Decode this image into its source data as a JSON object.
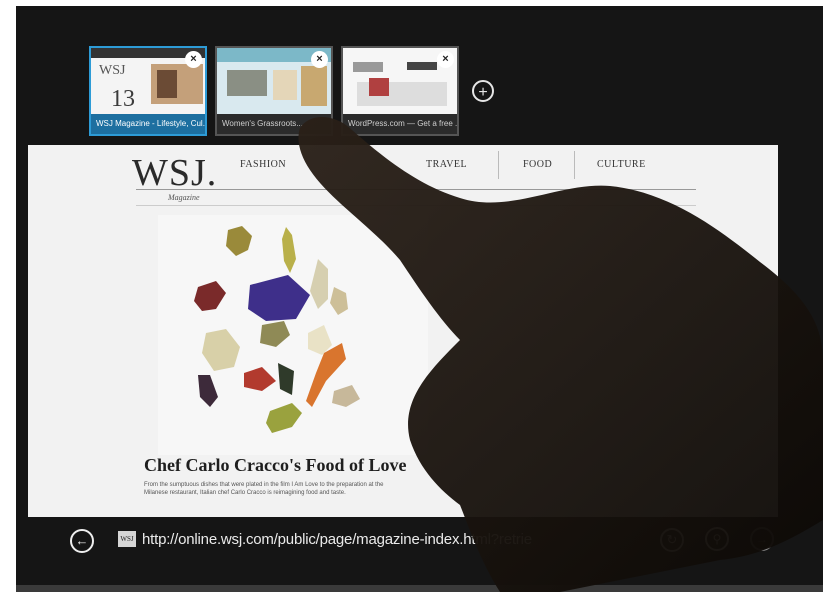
{
  "tabs": [
    {
      "caption": "WSJ Magazine - Lifestyle, Cul...",
      "active": true
    },
    {
      "caption": "Women's Grassroots...",
      "active": false
    },
    {
      "caption": "WordPress.com — Get a free ...",
      "active": false
    }
  ],
  "icons": {
    "close": "×",
    "new_tab": "+",
    "back": "←",
    "refresh": "↻",
    "pin": "⚲",
    "forward": "→",
    "favicon": "WSJ"
  },
  "page": {
    "logo": "WSJ.",
    "logo_sub": "Magazine",
    "nav": [
      "FASHION",
      "TRAVEL",
      "FOOD",
      "CULTURE"
    ],
    "article_title": "Chef Carlo Cracco's Food of Love",
    "article_text": "From the sumptuous dishes that were plated in the film I Am Love to the preparation at the Milanese restaurant, Italian chef Carlo Cracco is reimagining food and taste."
  },
  "address_bar": {
    "url": "http://online.wsj.com/public/page/magazine-index.html?retrie"
  },
  "colors": {
    "active_tab": "#2d9bd6",
    "background": "#151515",
    "page": "#f2f2f2"
  }
}
